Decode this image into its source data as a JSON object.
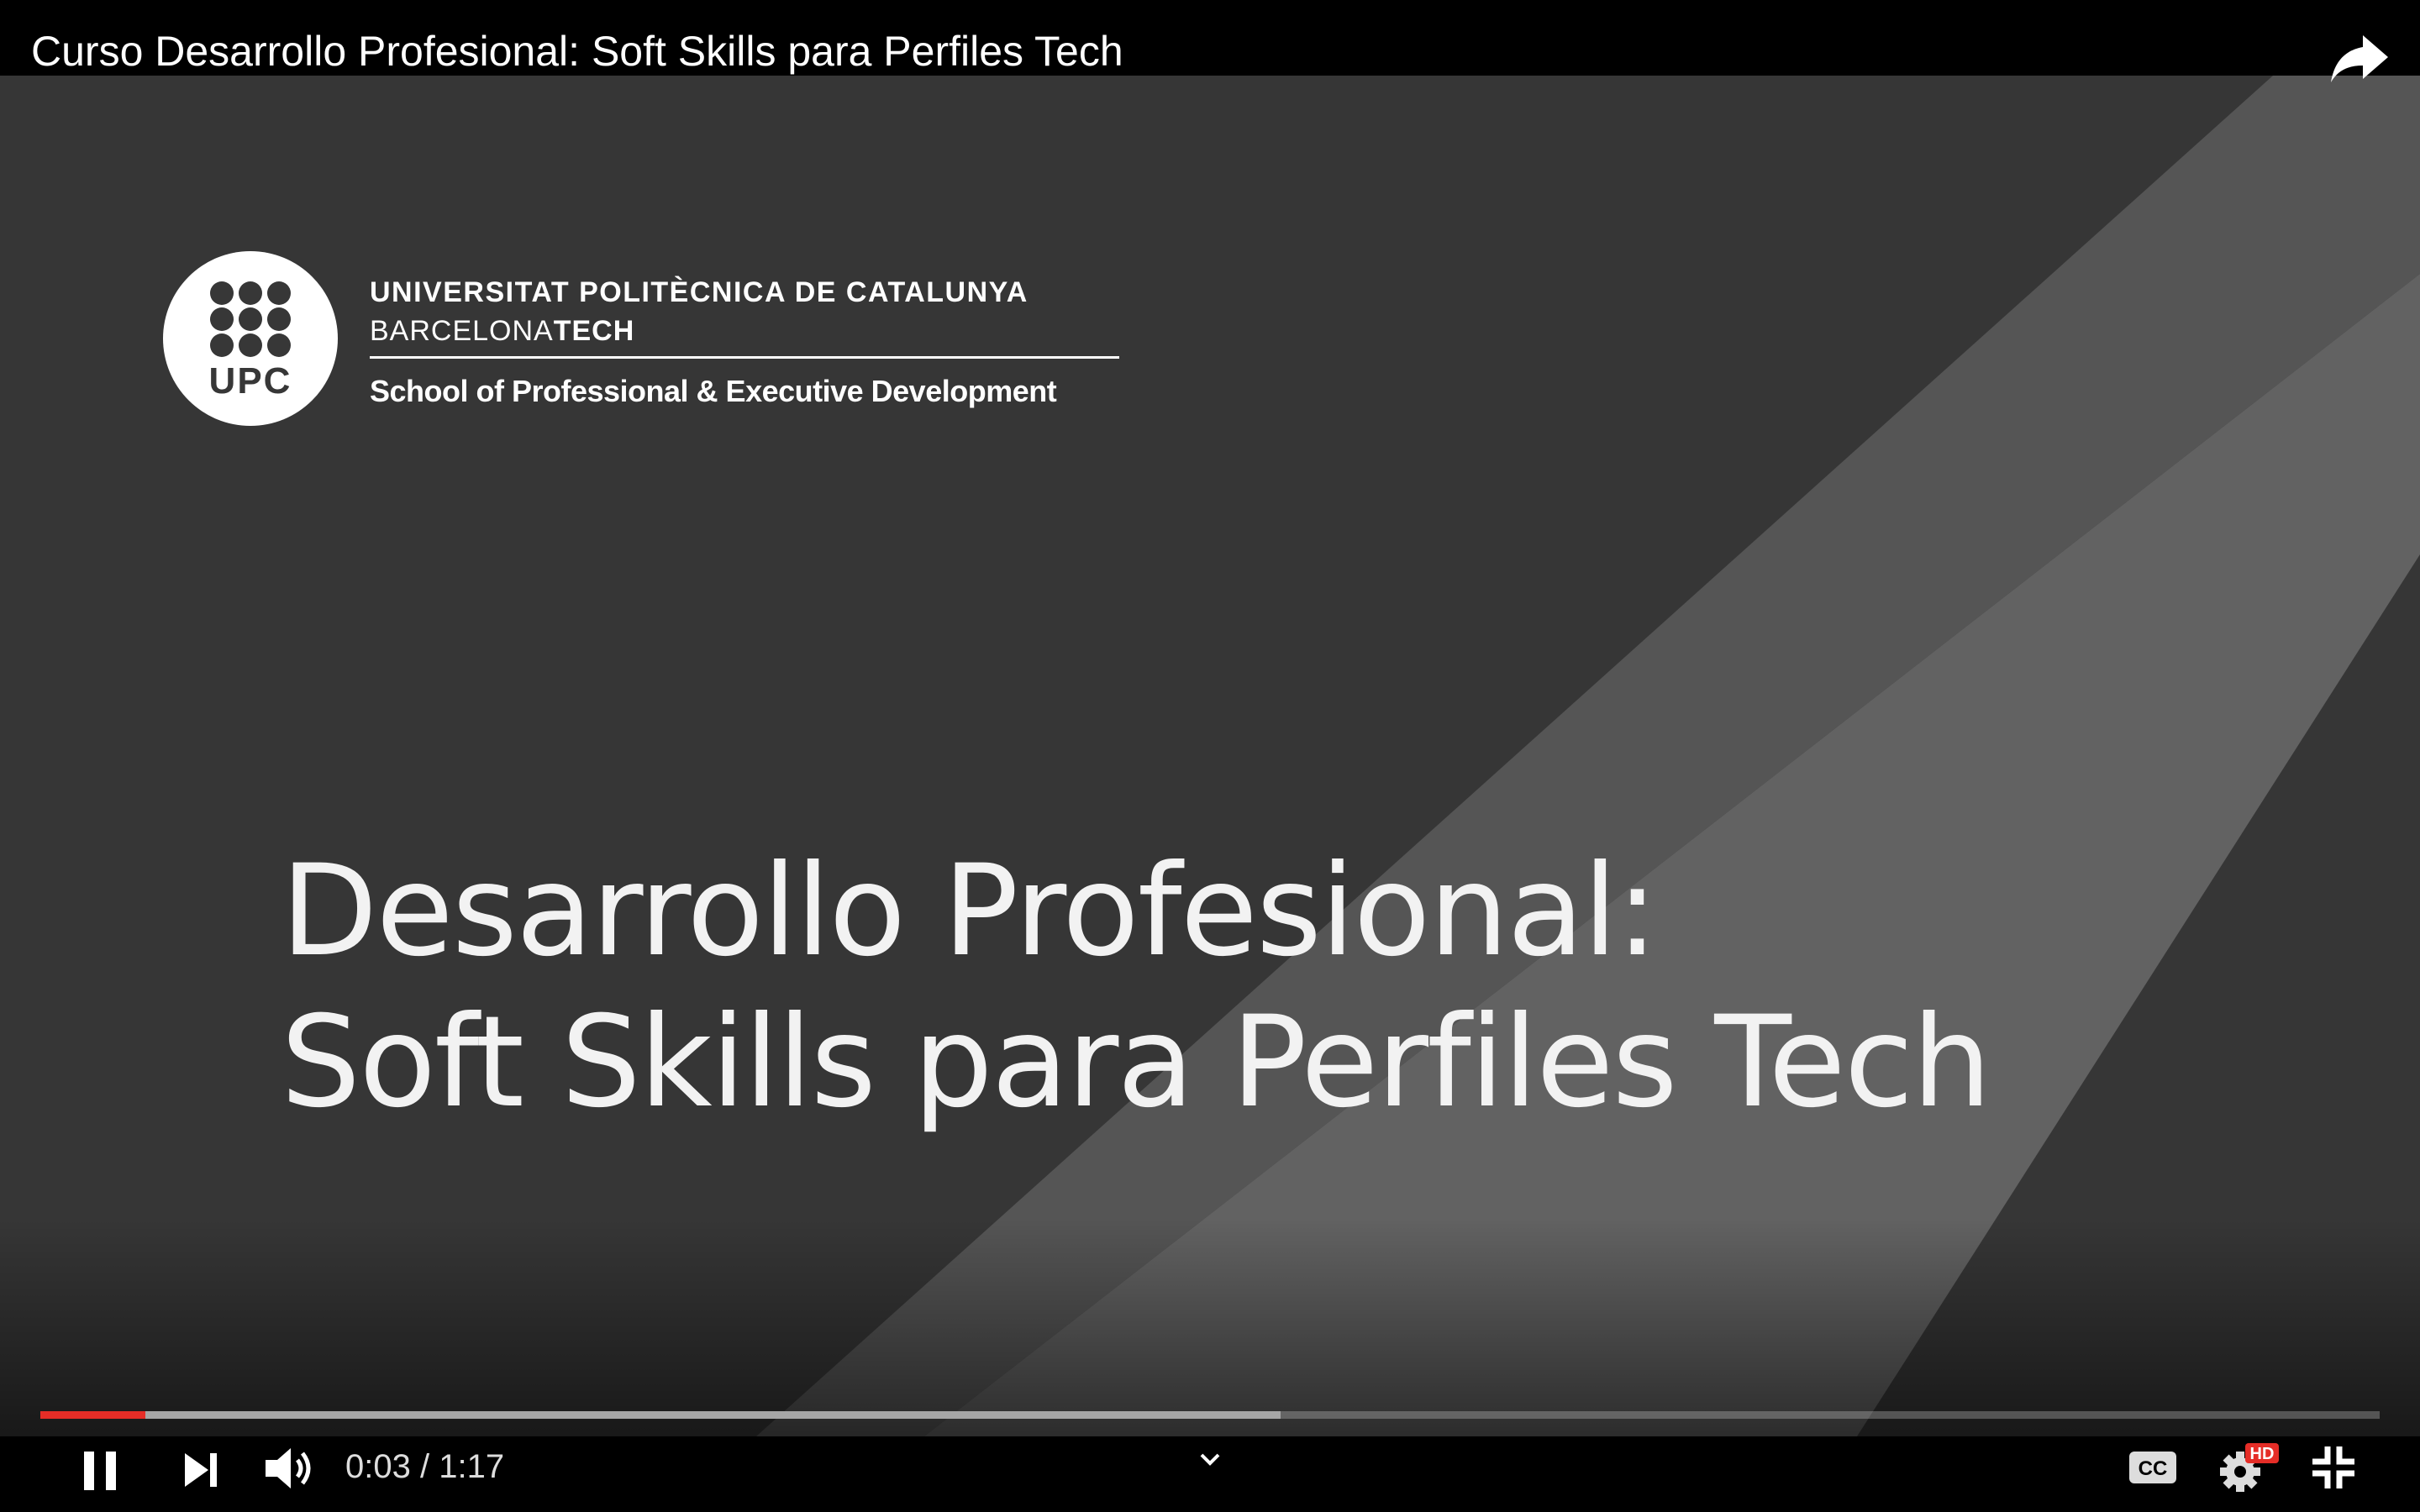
{
  "player": {
    "title": "Curso Desarrollo Profesional: Soft Skills para Perfiles Tech",
    "current_time": "0:03",
    "separator": "/",
    "duration": "1:17",
    "progress_played_fraction": 0.045,
    "progress_buffered_fraction": 0.53,
    "accent_color": "#e52d27",
    "quality_badge": "HD",
    "icons": {
      "share": "share-icon",
      "pause": "pause-icon",
      "next": "next-icon",
      "volume": "volume-icon",
      "more": "chevron-down-icon",
      "captions": "captions-icon",
      "settings": "settings-icon",
      "exit_fullscreen": "exit-fullscreen-icon"
    }
  },
  "slide": {
    "logo_abbr": "UPC",
    "university_name": "UNIVERSITAT POLITÈCNICA DE CATALUNYA",
    "campus_prefix": "BARCELONA",
    "campus_suffix": "TECH",
    "school": "School of Professional & Executive Development",
    "title_line1": "Desarrollo Profesional:",
    "title_line2": "Soft Skills para Perfiles Tech"
  }
}
